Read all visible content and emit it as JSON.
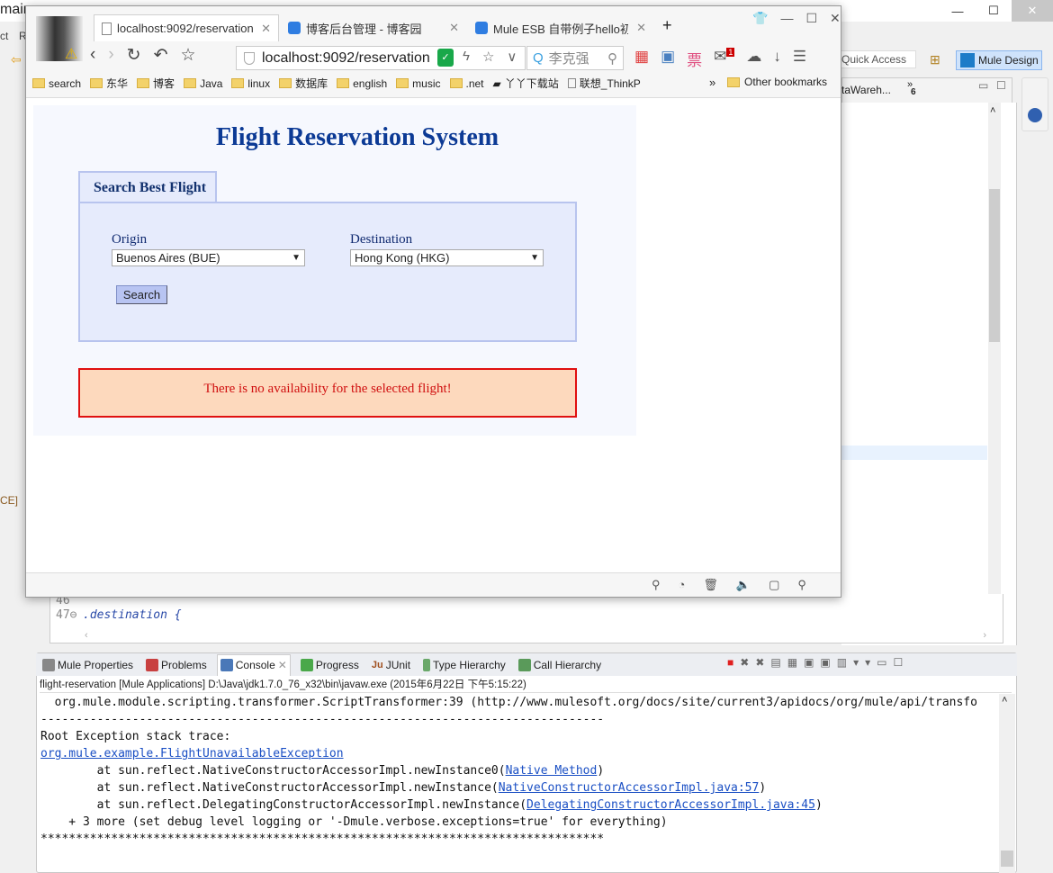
{
  "eclipse": {
    "title_fragment": "mair",
    "menu_fragment_1": "ct",
    "menu_fragment_2": "R",
    "quick_access": "Quick Access",
    "perspective": "Mule Design",
    "editor_tab_fragment": "taWareh...",
    "overflow_count": "6",
    "left_fragment": "CE]",
    "editor_lines": [
      {
        "num": "46",
        "text": ""
      },
      {
        "num": "47⊖",
        "text": ".destination {"
      }
    ],
    "console": {
      "tabs": [
        "Mule Properties",
        "Problems",
        "Console",
        "Progress",
        "JUnit",
        "Type Hierarchy",
        "Call Hierarchy"
      ],
      "active_tab": "Console",
      "description": "flight-reservation [Mule Applications] D:\\Java\\jdk1.7.0_76_x32\\bin\\javaw.exe (2015年6月22日 下午5:15:22)",
      "lines": [
        {
          "text": "  org.mule.module.scripting.transformer.ScriptTransformer:39 (http://www.mulesoft.org/docs/site/current3/apidocs/org/mule/api/transfo"
        },
        {
          "text": "--------------------------------------------------------------------------------"
        },
        {
          "text": "Root Exception stack trace:"
        },
        {
          "link": "org.mule.example.FlightUnavailableException"
        },
        {
          "text": "        at sun.reflect.NativeConstructorAccessorImpl.newInstance0(",
          "link": "Native Method",
          "after": ")"
        },
        {
          "text": "        at sun.reflect.NativeConstructorAccessorImpl.newInstance(",
          "link": "NativeConstructorAccessorImpl.java:57",
          "after": ")"
        },
        {
          "text": "        at sun.reflect.DelegatingConstructorAccessorImpl.newInstance(",
          "link": "DelegatingConstructorAccessorImpl.java:45",
          "after": ")"
        },
        {
          "text": "    + 3 more (set debug level logging or '-Dmule.verbose.exceptions=true' for everything)"
        },
        {
          "text": "********************************************************************************"
        }
      ]
    }
  },
  "browser": {
    "tabs": [
      {
        "label": "localhost:9092/reservation",
        "active": true
      },
      {
        "label": "博客后台管理 - 博客园",
        "active": false
      },
      {
        "label": "Mule ESB 自带例子hello初",
        "active": false
      }
    ],
    "url": "localhost:9092/reservation",
    "search_value": "李克强",
    "bookmarks": [
      "search",
      "东华",
      "博客",
      "Java",
      "linux",
      "数据库",
      "english",
      "music",
      ".net",
      "丫丫下载站",
      "联想_ThinkP"
    ],
    "bookmarks_more": "»",
    "other_bookmarks": "Other bookmarks",
    "mail_badge": "1"
  },
  "page": {
    "title": "Flight Reservation System",
    "tab_label": "Search Best Flight",
    "origin_label": "Origin",
    "origin_value": "Buenos Aires (BUE)",
    "destination_label": "Destination",
    "destination_value": "Hong Kong (HKG)",
    "search_button": "Search",
    "error_message": "There is no availability for the selected flight!"
  }
}
